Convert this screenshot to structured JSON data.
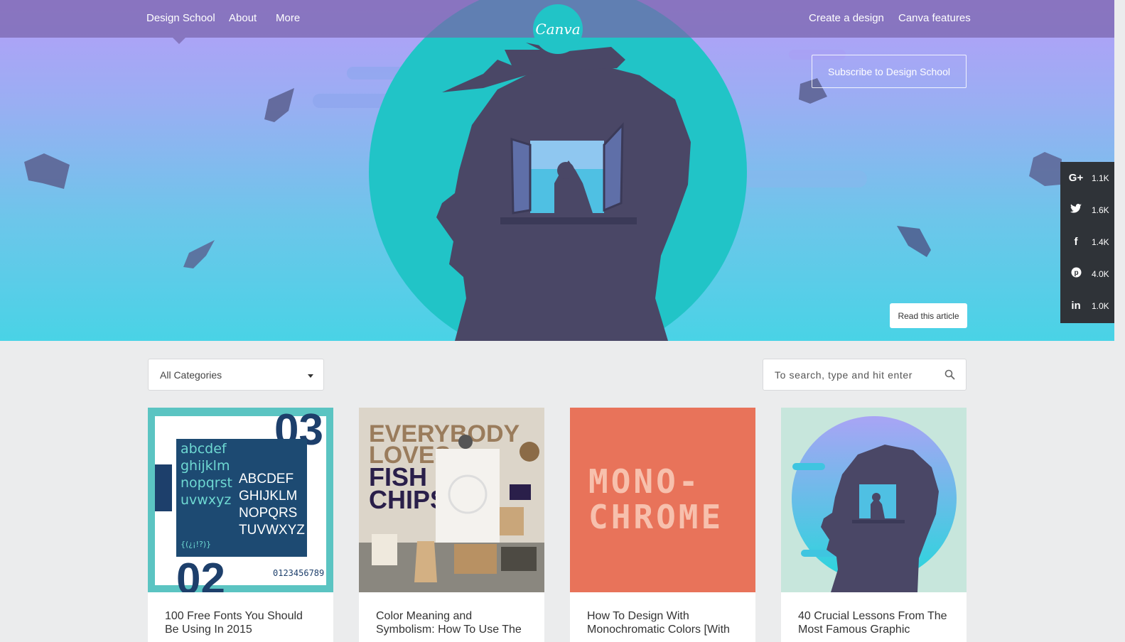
{
  "nav": {
    "left": [
      "Design School",
      "About",
      "More"
    ],
    "logo": "Canva",
    "right": [
      "Create a design",
      "Canva features"
    ]
  },
  "hero": {
    "subscribe_label": "Subscribe to Design School",
    "read_label": "Read this article"
  },
  "social": [
    {
      "icon": "google-plus-icon",
      "glyph": "G+",
      "count": "1.1K"
    },
    {
      "icon": "twitter-icon",
      "glyph": "t",
      "count": "1.6K"
    },
    {
      "icon": "facebook-icon",
      "glyph": "f",
      "count": "1.4K"
    },
    {
      "icon": "pinterest-icon",
      "glyph": "p",
      "count": "4.0K"
    },
    {
      "icon": "linkedin-icon",
      "glyph": "in",
      "count": "1.0K"
    }
  ],
  "filters": {
    "category_selected": "All Categories",
    "search_placeholder": "To search, type and hit enter"
  },
  "thumbs": {
    "fonts": {
      "lower": [
        "abcdef",
        "ghijklm",
        "nopqrst",
        "uvwxyz"
      ],
      "upper": [
        "ABCDEF",
        "GHIJKLM",
        "NOPQRS",
        "TUVWXYZ"
      ],
      "symbols": "{(¿¡!?)}",
      "digits": "0123456789",
      "num_top": "03",
      "num_bottom": "02"
    },
    "fish": [
      "EVERYBODY",
      "LOVES",
      "FISH",
      "CHIPS"
    ],
    "mono": [
      "MONO-",
      "CHROME"
    ]
  },
  "cards": [
    {
      "title": "100 Free Fonts You Should Be Using In 2015"
    },
    {
      "title": "Color Meaning and Symbolism: How To Use The"
    },
    {
      "title": "How To Design With Monochromatic Colors [With"
    },
    {
      "title": "40 Crucial Lessons From The Most Famous Graphic"
    }
  ],
  "colors": {
    "topbar": "#7864aa",
    "teal": "#21c4c7",
    "silhouette": "#4a4766",
    "social_bg": "#2f3338",
    "coral": "#e8735a"
  }
}
